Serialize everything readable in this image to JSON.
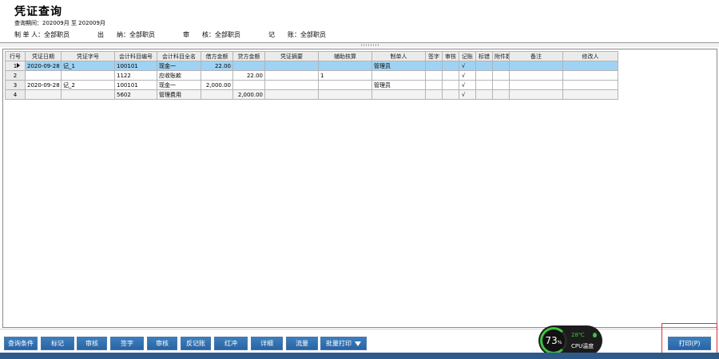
{
  "header": {
    "title": "凭证查询",
    "period_label": "查询期间：",
    "period_value": "202009月 至 202009月",
    "meta": [
      {
        "label": "制 单 人：",
        "value": "全部职员"
      },
      {
        "label": "出　　纳：",
        "value": "全部职员"
      },
      {
        "label": "审　　核：",
        "value": "全部职员"
      },
      {
        "label": "记　　账：",
        "value": "全部职员"
      }
    ]
  },
  "grid": {
    "columns": [
      "行号",
      "凭证日期",
      "凭证字号",
      "会计科目编号",
      "会计科目全名",
      "借方金额",
      "贷方金额",
      "凭证摘要",
      "辅助核算",
      "制单人",
      "签字",
      "审核",
      "记账",
      "标错",
      "附件数",
      "备注",
      "修改人"
    ],
    "rows": [
      {
        "no": "1",
        "date": "2020-09-28",
        "voucher": "记_1",
        "code": "100101",
        "name": "现金一",
        "debit": "22.00",
        "credit": "",
        "summary": "",
        "aux": "",
        "maker": "管理员",
        "sign": "",
        "audit": "",
        "post": "√",
        "flag": "",
        "attach": "",
        "note": "",
        "modifier": "",
        "state": "sel"
      },
      {
        "no": "2",
        "date": "",
        "voucher": "",
        "code": "1122",
        "name": "应收账款",
        "debit": "",
        "credit": "22.00",
        "summary": "",
        "aux": "1",
        "maker": "",
        "sign": "",
        "audit": "",
        "post": "√",
        "flag": "",
        "attach": "",
        "note": "",
        "modifier": "",
        "state": ""
      },
      {
        "no": "3",
        "date": "2020-09-28",
        "voucher": "记_2",
        "code": "100101",
        "name": "现金一",
        "debit": "2,000.00",
        "credit": "",
        "summary": "",
        "aux": "",
        "maker": "管理员",
        "sign": "",
        "audit": "",
        "post": "√",
        "flag": "",
        "attach": "",
        "note": "",
        "modifier": "",
        "state": ""
      },
      {
        "no": "4",
        "date": "",
        "voucher": "",
        "code": "5602",
        "name": "管理费用",
        "debit": "",
        "credit": "2,000.00",
        "summary": "",
        "aux": "",
        "maker": "",
        "sign": "",
        "audit": "",
        "post": "√",
        "flag": "",
        "attach": "",
        "note": "",
        "modifier": "",
        "state": "alt"
      }
    ]
  },
  "toolbar": {
    "buttons": [
      "查询条件",
      "标记",
      "审核",
      "签字",
      "审核",
      "反记账",
      "红冲",
      "详细",
      "流量",
      "批量打印"
    ],
    "print_label": "打印(P)"
  },
  "cpu_widget": {
    "percent": "73",
    "percent_unit": "%",
    "temperature": "28℃",
    "label": "CPU温度"
  }
}
